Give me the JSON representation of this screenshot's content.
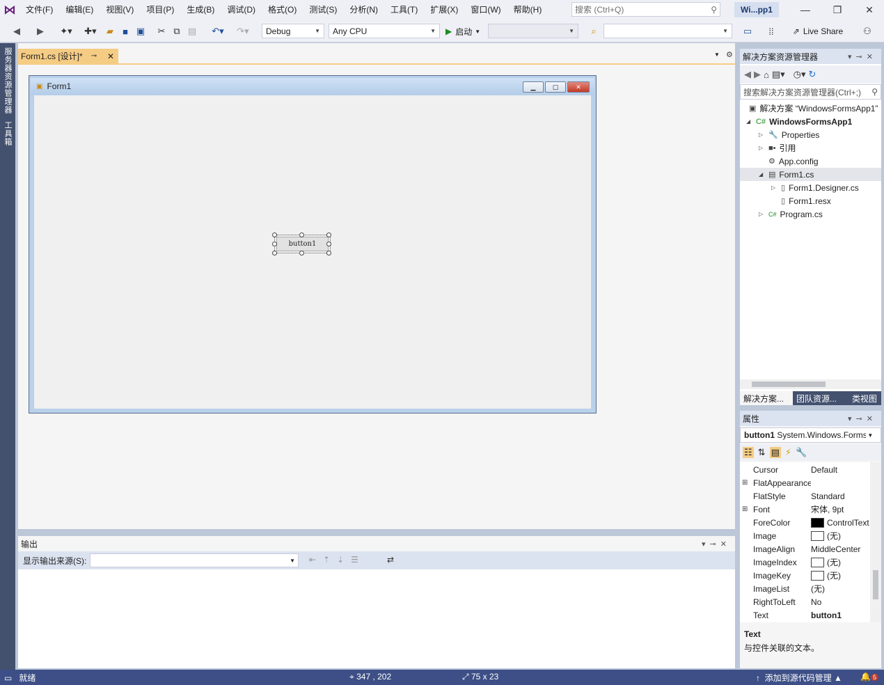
{
  "menubar": {
    "items": [
      "文件(F)",
      "编辑(E)",
      "视图(V)",
      "项目(P)",
      "生成(B)",
      "调试(D)",
      "格式(O)",
      "测试(S)",
      "分析(N)",
      "工具(T)",
      "扩展(X)",
      "窗口(W)",
      "帮助(H)"
    ],
    "search_placeholder": "搜索 (Ctrl+Q)",
    "solution_badge": "Wi...pp1"
  },
  "toolbar": {
    "config": "Debug",
    "platform": "Any CPU",
    "start_label": "启动",
    "live_share": "Live Share"
  },
  "left_strip": {
    "tabs": [
      "服务器资源管理器",
      "工具箱"
    ]
  },
  "document": {
    "tab_label": "Form1.cs [设计]*",
    "form_title": "Form1",
    "button_text": "button1"
  },
  "output": {
    "title": "输出",
    "source_label": "显示输出来源(S):"
  },
  "solution_explorer": {
    "title": "解决方案资源管理器",
    "search_placeholder": "搜索解决方案资源管理器(Ctrl+;)",
    "tree": [
      {
        "label": "解决方案 “WindowsFormsApp1”",
        "level": 0
      },
      {
        "label": "WindowsFormsApp1",
        "level": 1
      },
      {
        "label": "Properties",
        "level": 2
      },
      {
        "label": "引用",
        "level": 2
      },
      {
        "label": "App.config",
        "level": 2
      },
      {
        "label": "Form1.cs",
        "level": 2
      },
      {
        "label": "Form1.Designer.cs",
        "level": 3
      },
      {
        "label": "Form1.resx",
        "level": 3
      },
      {
        "label": "Program.cs",
        "level": 2
      }
    ],
    "tabs": [
      "解决方案...",
      "团队资源...",
      "类视图"
    ]
  },
  "properties": {
    "title": "属性",
    "object_name": "button1",
    "object_type": "System.Windows.Forms.Button",
    "rows": [
      {
        "name": "Cursor",
        "value": "Default",
        "expandable": false,
        "swatch": ""
      },
      {
        "name": "FlatAppearance",
        "value": "",
        "expandable": true,
        "swatch": ""
      },
      {
        "name": "FlatStyle",
        "value": "Standard",
        "expandable": false,
        "swatch": ""
      },
      {
        "name": "Font",
        "value": "宋体, 9pt",
        "expandable": true,
        "swatch": ""
      },
      {
        "name": "ForeColor",
        "value": "ControlText",
        "expandable": false,
        "swatch": "#000000"
      },
      {
        "name": "Image",
        "value": "(无)",
        "expandable": false,
        "swatch": "#ffffff"
      },
      {
        "name": "ImageAlign",
        "value": "MiddleCenter",
        "expandable": false,
        "swatch": ""
      },
      {
        "name": "ImageIndex",
        "value": "(无)",
        "expandable": false,
        "swatch": "#ffffff"
      },
      {
        "name": "ImageKey",
        "value": "(无)",
        "expandable": false,
        "swatch": "#ffffff"
      },
      {
        "name": "ImageList",
        "value": "(无)",
        "expandable": false,
        "swatch": ""
      },
      {
        "name": "RightToLeft",
        "value": "No",
        "expandable": false,
        "swatch": ""
      },
      {
        "name": "Text",
        "value": "button1",
        "expandable": false,
        "swatch": ""
      }
    ],
    "desc_title": "Text",
    "desc_text": "与控件关联的文本。"
  },
  "statusbar": {
    "ready": "就绪",
    "position": "347 , 202",
    "size": "75 x 23",
    "source_control": "添加到源代码管理",
    "notifications": "5"
  },
  "colors": {
    "accent_tab": "#f5cc84",
    "statusbar": "#3d4f86",
    "vs_purple": "#68217a"
  }
}
